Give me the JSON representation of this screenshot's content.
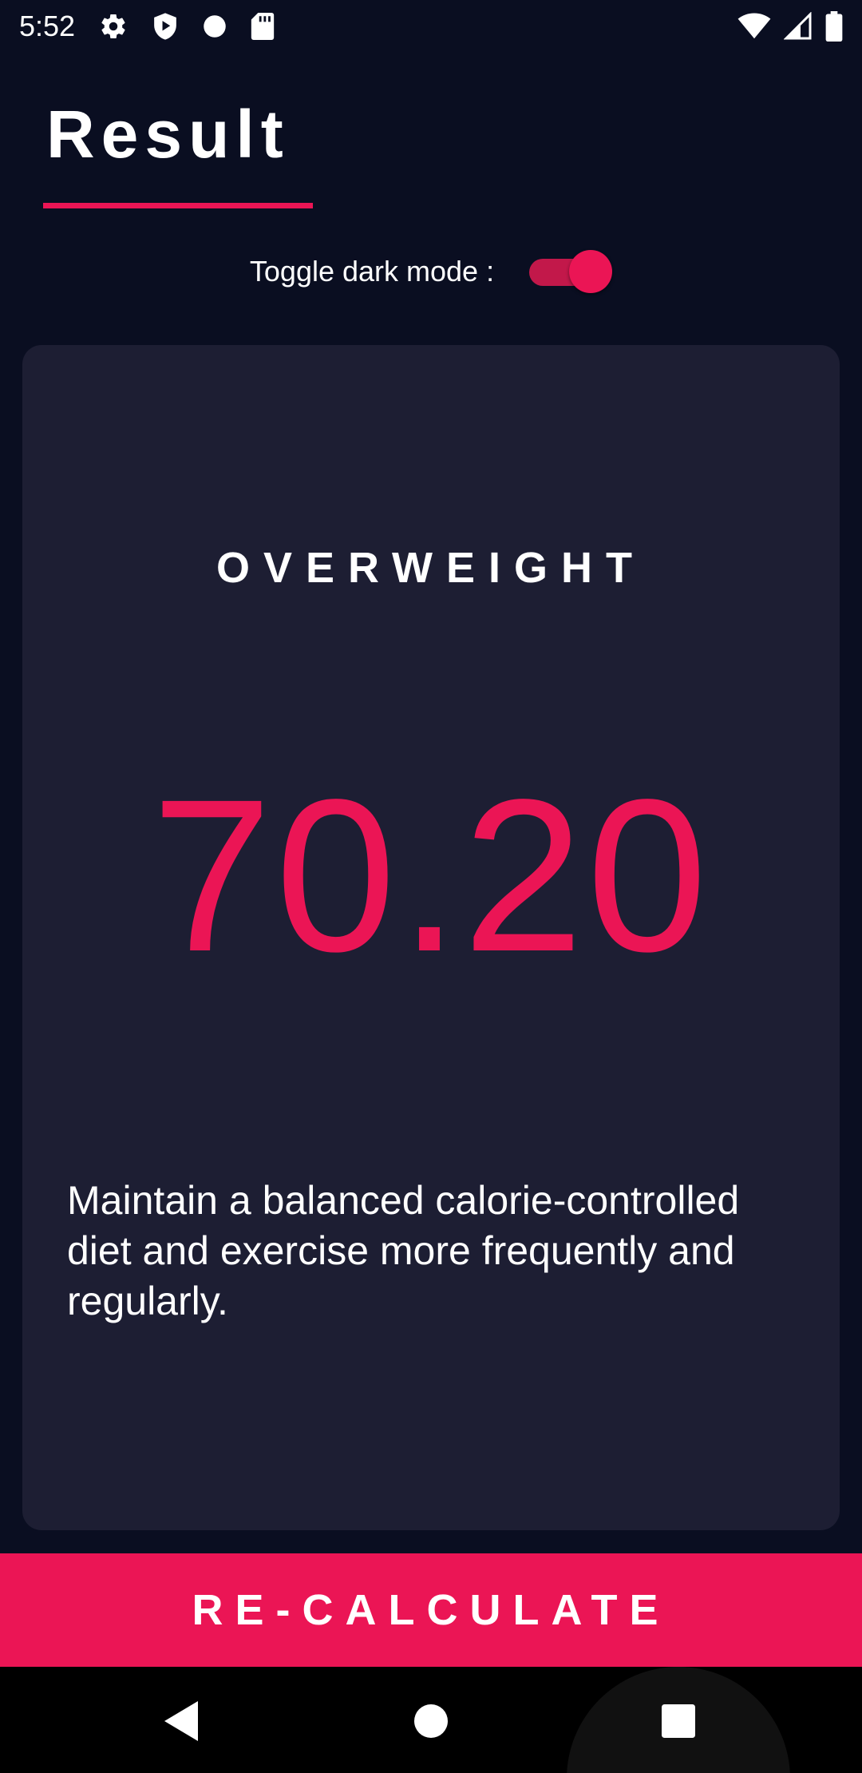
{
  "status_bar": {
    "time": "5:52",
    "left_icons": [
      "settings-icon",
      "shield-icon",
      "dot-icon",
      "sd-card-icon"
    ],
    "right_icons": [
      "wifi-icon",
      "signal-icon",
      "battery-icon"
    ]
  },
  "header": {
    "title": "Result"
  },
  "theme_toggle": {
    "label": "Toggle dark mode :",
    "on": true
  },
  "result": {
    "category": "OVERWEIGHT",
    "bmi": "70.20",
    "advice": "Maintain a balanced calorie-controlled diet and exercise more frequently and regularly."
  },
  "actions": {
    "recalculate_label": "RE-CALCULATE"
  },
  "nav_bar": {
    "buttons": [
      "back-icon",
      "home-icon",
      "recents-icon"
    ]
  },
  "colors": {
    "background": "#0a0e21",
    "card": "#1d1e33",
    "accent": "#eb1555",
    "text": "#ffffff"
  }
}
